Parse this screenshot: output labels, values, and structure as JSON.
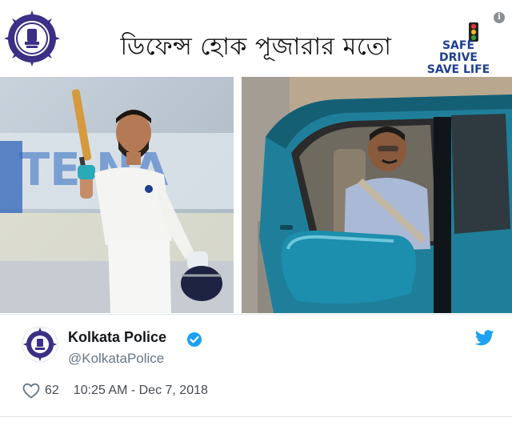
{
  "poster": {
    "headline": "ডিফেন্স হোক পূজারার মতো",
    "campaign_line1": "SAFE DRIVE",
    "campaign_line2": "SAVE LIFE",
    "info_glyph": "i",
    "photo_left_subject": "cricketer-celebrating",
    "photo_right_subject": "driver-in-car-with-seatbelt",
    "background_banner_text": "TE NA"
  },
  "tweet": {
    "display_name": "Kolkata Police",
    "handle": "@KolkataPolice",
    "likes": "62",
    "timestamp": "10:25 AM - Dec 7, 2018"
  },
  "colors": {
    "twitter_blue": "#1da1f2",
    "verified_blue": "#1da1f2",
    "campaign_blue": "#1d3f8f",
    "emblem_purple": "#3b2f86",
    "car_teal": "#1f7f9a"
  },
  "icons": [
    "kolkata-police-emblem-icon",
    "traffic-light-icon",
    "info-icon",
    "verified-badge-icon",
    "twitter-bird-icon",
    "heart-icon"
  ]
}
